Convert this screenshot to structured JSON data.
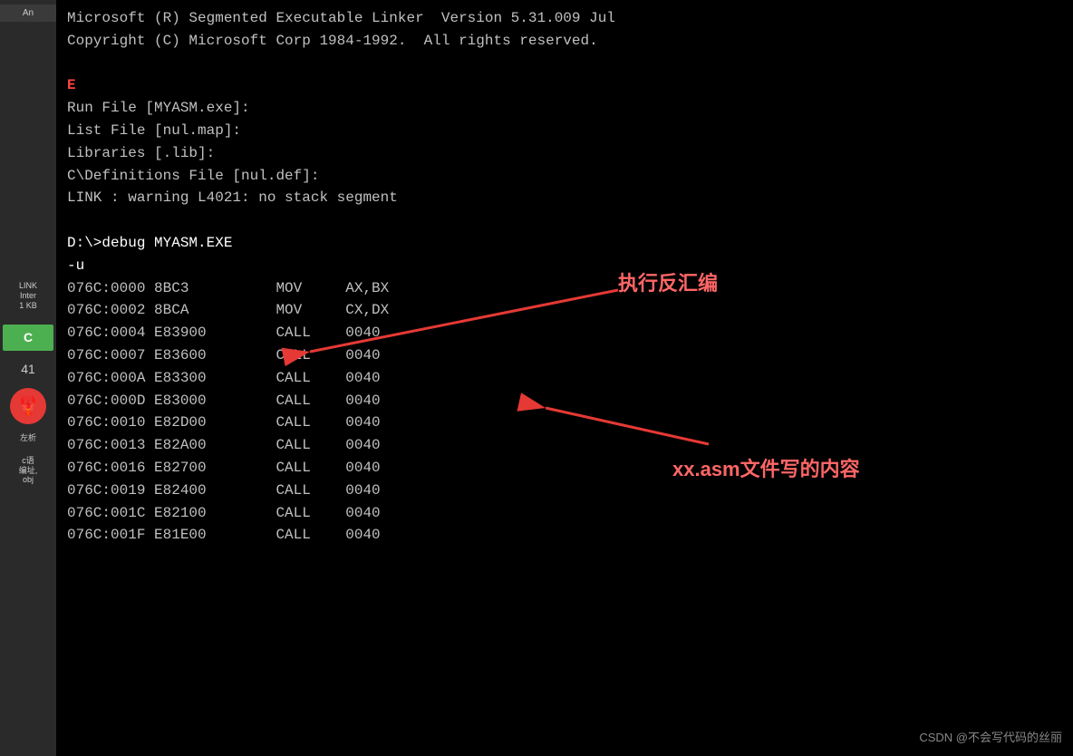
{
  "sidebar": {
    "header_text": "An",
    "items": [
      {
        "label": "LINK\nInter\n1 KB",
        "type": "text"
      },
      {
        "label": "C",
        "type": "green-bg"
      },
      {
        "label": "41",
        "type": "text"
      },
      {
        "label": "🦞\n左析",
        "type": "avatar"
      },
      {
        "label": "c语\n编址",
        "type": "text"
      }
    ]
  },
  "terminal": {
    "lines": [
      "Microsoft (R) Segmented Executable Linker  Version 5.31.009 Jul",
      "Copyright (C) Microsoft Corp 1984-1992.  All rights reserved.",
      "",
      "Run File [MYASM.exe]:",
      "List File [nul.map]:",
      "Libraries [.lib]:",
      "C\\Definitions File [nul.def]:",
      "LINK : warning L4021: no stack segment",
      "",
      "D:\\>debug MYASM.EXE",
      "-u",
      "076C:0000 8BC3          MOV     AX,BX",
      "076C:0002 8BCA          MOV     CX,DX",
      "076C:0004 E83900        CALL    0040",
      "076C:0007 E83600        CALL    0040",
      "076C:000A E83300        CALL    0040",
      "076C:000D E83000        CALL    0040",
      "076C:0010 E82D00        CALL    0040",
      "076C:0013 E82A00        CALL    0040",
      "076C:0016 E82700        CALL    0040",
      "076C:0019 E82400        CALL    0040",
      "076C:001C E82100        CALL    0040",
      "076C:001F E81E00        CALL    0040"
    ],
    "red_marker": "E",
    "annotation1_text": "执行反汇编",
    "annotation2_text": "xx.asm文件写的内容"
  },
  "watermark": "CSDN @不会写代码的丝丽",
  "sidebar_labels": {
    "an": "An",
    "link_label": "LINK\nInter\n1 KB",
    "c_label": "C",
    "num_label": "41",
    "c_lang_label": "c语\n编址,\nobj"
  }
}
